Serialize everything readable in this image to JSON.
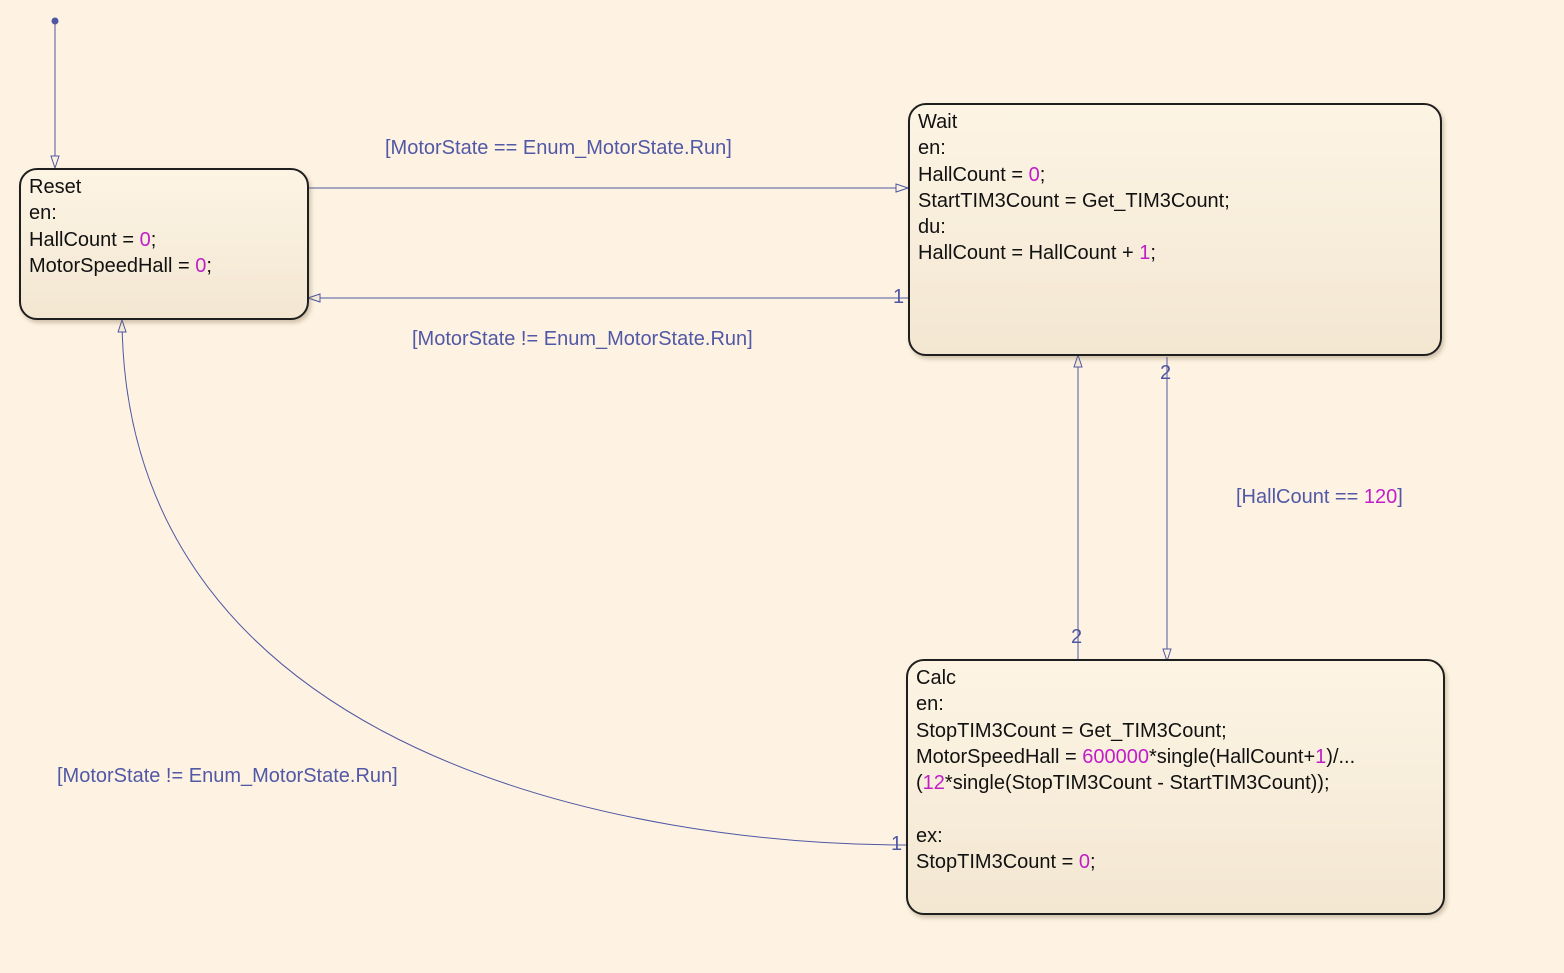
{
  "states": {
    "reset": {
      "name": "Reset",
      "lines": [
        [
          {
            "t": "en:"
          }
        ],
        [
          {
            "t": "HallCount = "
          },
          {
            "t": "0",
            "n": true
          },
          {
            "t": ";"
          }
        ],
        [
          {
            "t": "MotorSpeedHall = "
          },
          {
            "t": "0",
            "n": true
          },
          {
            "t": ";"
          }
        ]
      ]
    },
    "wait": {
      "name": "Wait",
      "lines": [
        [
          {
            "t": "en:"
          }
        ],
        [
          {
            "t": "HallCount = "
          },
          {
            "t": "0",
            "n": true
          },
          {
            "t": ";"
          }
        ],
        [
          {
            "t": "StartTIM3Count = Get_TIM3Count;"
          }
        ],
        [
          {
            "t": "du:"
          }
        ],
        [
          {
            "t": "HallCount = HallCount + "
          },
          {
            "t": "1",
            "n": true
          },
          {
            "t": ";"
          }
        ]
      ]
    },
    "calc": {
      "name": "Calc",
      "lines": [
        [
          {
            "t": "en:"
          }
        ],
        [
          {
            "t": "StopTIM3Count = Get_TIM3Count;"
          }
        ],
        [
          {
            "t": "MotorSpeedHall = "
          },
          {
            "t": "600000",
            "n": true
          },
          {
            "t": "*single(HallCount+"
          },
          {
            "t": "1",
            "n": true
          },
          {
            "t": ")/..."
          }
        ],
        [
          {
            "t": "("
          },
          {
            "t": "12",
            "n": true
          },
          {
            "t": "*single(StopTIM3Count - StartTIM3Count));"
          }
        ],
        [
          {
            "t": ""
          }
        ],
        [
          {
            "t": "ex:"
          }
        ],
        [
          {
            "t": "StopTIM3Count = "
          },
          {
            "t": "0",
            "n": true
          },
          {
            "t": ";"
          }
        ]
      ]
    }
  },
  "transitions": {
    "reset_to_wait": {
      "label": "[MotorState == Enum_MotorState.Run]"
    },
    "wait_to_reset": {
      "label": "[MotorState != Enum_MotorState.Run]",
      "order": "1"
    },
    "wait_to_calc": {
      "label_pre": "[HallCount == ",
      "label_num": "120",
      "label_post": "]",
      "order": "2"
    },
    "calc_to_wait": {
      "order": "2"
    },
    "calc_to_reset": {
      "label": "[MotorState != Enum_MotorState.Run]",
      "order": "1"
    }
  },
  "colors": {
    "background": "#fef3e2",
    "transition": "#4f57a3",
    "constant": "#c21ec8",
    "state_border": "#1f1f1f"
  }
}
